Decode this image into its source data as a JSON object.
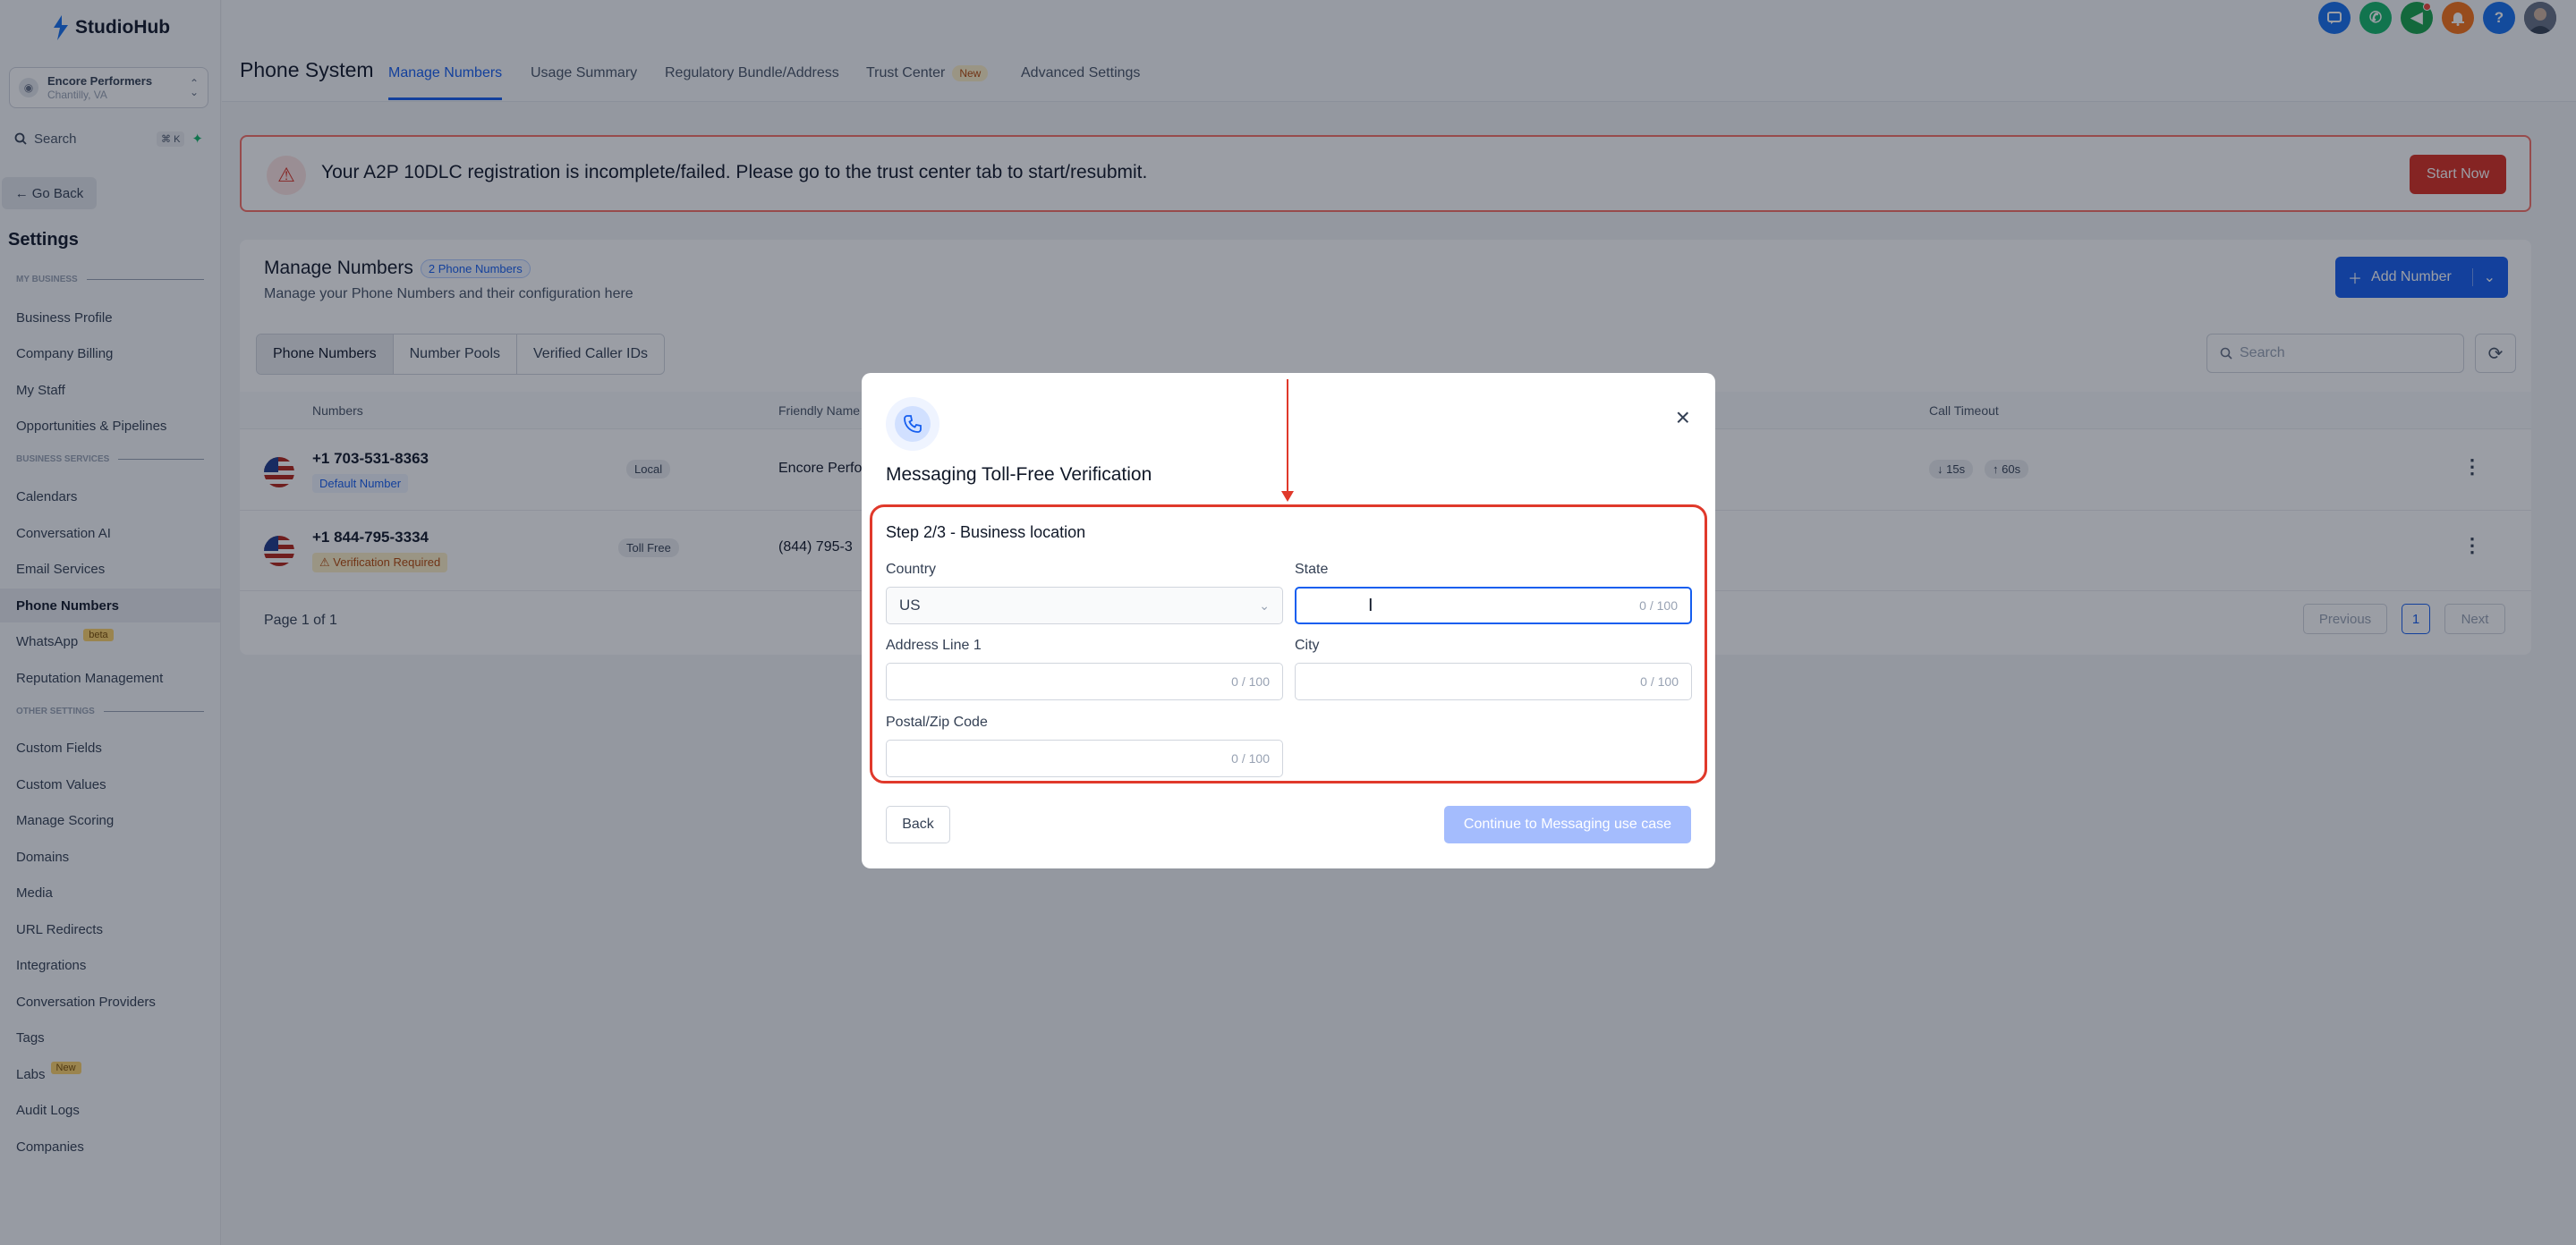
{
  "app": {
    "brand": "StudioHub"
  },
  "account": {
    "name": "Encore Performers",
    "location": "Chantilly, VA"
  },
  "sidebar": {
    "search_label": "Search",
    "search_shortcut": "⌘ K",
    "go_back": "Go Back",
    "settings_title": "Settings",
    "sections": {
      "my_business": "MY BUSINESS",
      "business_services": "BUSINESS SERVICES",
      "other_settings": "OTHER SETTINGS"
    },
    "items": {
      "business_profile": "Business Profile",
      "company_billing": "Company Billing",
      "my_staff": "My Staff",
      "opportunities": "Opportunities & Pipelines",
      "calendars": "Calendars",
      "conversation_ai": "Conversation AI",
      "email_services": "Email Services",
      "phone_numbers": "Phone Numbers",
      "whatsapp": "WhatsApp",
      "whatsapp_badge": "beta",
      "reputation": "Reputation Management",
      "custom_fields": "Custom Fields",
      "custom_values": "Custom Values",
      "manage_scoring": "Manage Scoring",
      "domains": "Domains",
      "media": "Media",
      "url_redirects": "URL Redirects",
      "integrations": "Integrations",
      "conversation_providers": "Conversation Providers",
      "tags": "Tags",
      "labs": "Labs",
      "labs_badge": "New",
      "audit_logs": "Audit Logs",
      "companies": "Companies"
    }
  },
  "header": {
    "page_title": "Phone System",
    "tabs": {
      "manage_numbers": "Manage Numbers",
      "usage_summary": "Usage Summary",
      "regulatory": "Regulatory Bundle/Address",
      "trust_center": "Trust Center",
      "trust_center_badge": "New",
      "advanced": "Advanced Settings"
    },
    "icons": [
      "chat-icon",
      "phone-icon",
      "megaphone-icon",
      "bell-icon",
      "help-icon",
      "avatar"
    ],
    "help_glyph": "?"
  },
  "banner": {
    "message": "Your A2P 10DLC registration is incomplete/failed. Please go to the trust center tab to start/resubmit.",
    "button": "Start Now"
  },
  "manage": {
    "title": "Manage Numbers",
    "count_badge": "2 Phone Numbers",
    "subtitle": "Manage your Phone Numbers and their configuration here",
    "add_button": "Add Number",
    "segments": {
      "phone_numbers": "Phone Numbers",
      "number_pools": "Number Pools",
      "verified_caller_ids": "Verified Caller IDs"
    },
    "search_placeholder": "Search",
    "columns": {
      "numbers": "Numbers",
      "friendly_name": "Friendly Name",
      "call_timeout": "Call Timeout"
    },
    "rows": [
      {
        "number": "+1 703-531-8363",
        "badge": "Default Number",
        "type": "Local",
        "friendly": "Encore Perfo",
        "timeout_in": "↓ 15s",
        "timeout_out": "↑ 60s"
      },
      {
        "number": "+1 844-795-3334",
        "badge": "Verification Required",
        "type": "Toll Free",
        "friendly": "(844) 795-3"
      }
    ],
    "pagination": {
      "page_of": "Page 1 of 1",
      "previous": "Previous",
      "current": "1",
      "next": "Next"
    }
  },
  "modal": {
    "title": "Messaging Toll-Free Verification",
    "step": "Step 2/3 - Business location",
    "fields": {
      "country_label": "Country",
      "country_value": "US",
      "state_label": "State",
      "state_counter": "0 / 100",
      "address_label": "Address Line 1",
      "address_counter": "0 / 100",
      "city_label": "City",
      "city_counter": "0 / 100",
      "zip_label": "Postal/Zip Code",
      "zip_counter": "0 / 100"
    },
    "back": "Back",
    "continue": "Continue to Messaging use case"
  },
  "colors": {
    "primary": "#155eef",
    "danger": "#d92d20",
    "highlight": "#e0392b"
  }
}
